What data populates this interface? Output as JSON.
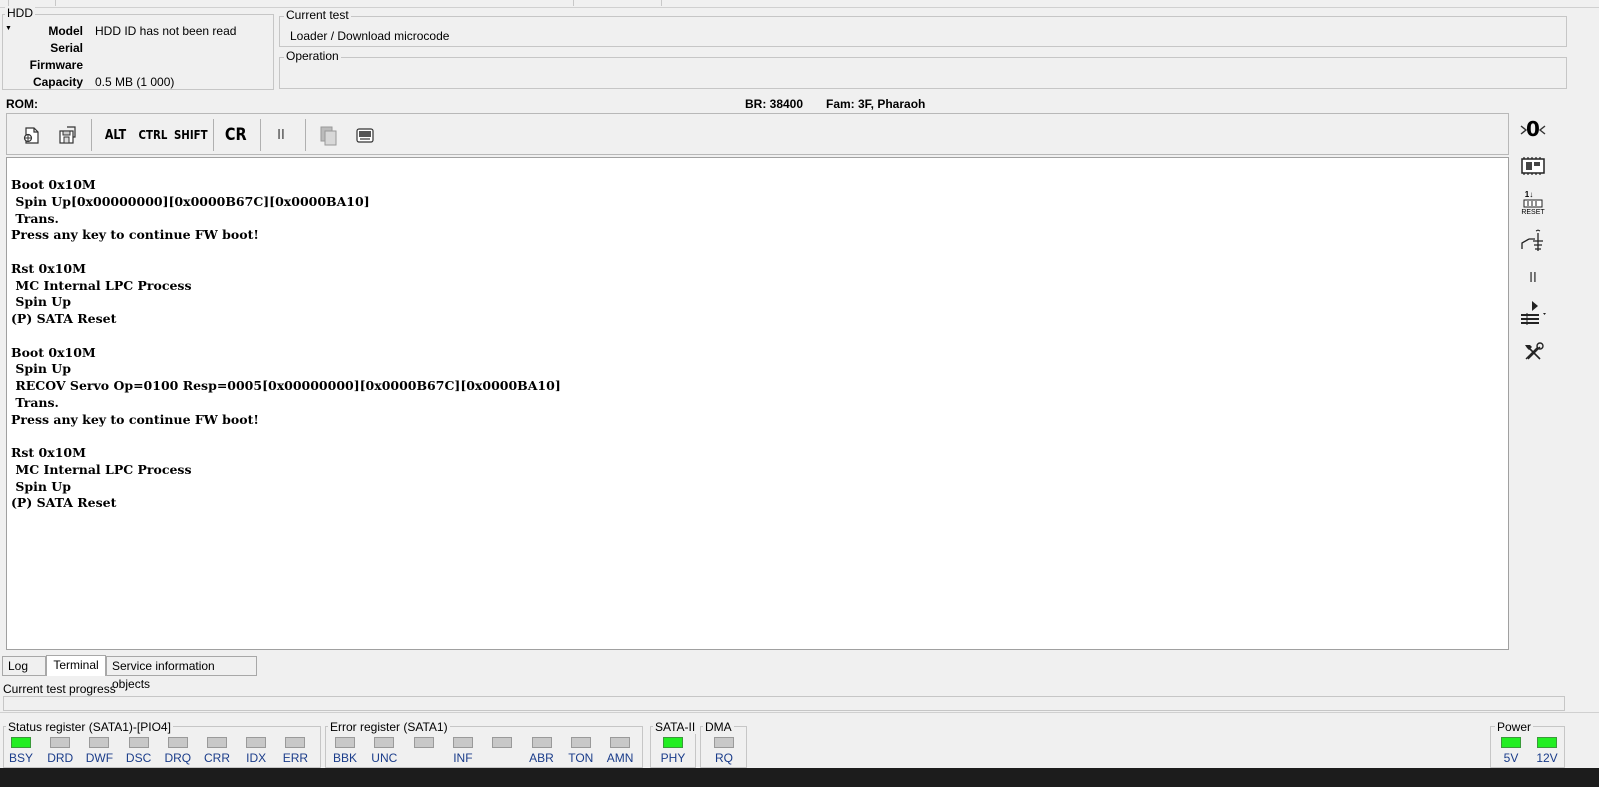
{
  "hdd": {
    "label": "HDD",
    "rows": [
      {
        "key": "Model",
        "value": "HDD ID has not been read"
      },
      {
        "key": "Serial",
        "value": ""
      },
      {
        "key": "Firmware",
        "value": ""
      },
      {
        "key": "Capacity",
        "value": "0.5 MB (1 000)"
      }
    ]
  },
  "current_test": {
    "label": "Current test",
    "value": "Loader / Download microcode"
  },
  "operation": {
    "label": "Operation",
    "value": ""
  },
  "status_line": {
    "rom": "ROM:",
    "br": "BR: 38400",
    "fam": "Fam: 3F, Pharaoh"
  },
  "toolbar": {
    "alt": "ALT",
    "ctrl": "CTRL",
    "shift": "SHIFT",
    "cr": "CR",
    "pause": "II"
  },
  "terminal_lines": [
    "Boot 0x10M",
    " Spin Up[0x00000000][0x0000B67C][0x0000BA10]",
    " Trans.",
    "Press any key to continue FW boot!",
    "",
    "Rst 0x10M",
    " MC Internal LPC Process",
    " Spin Up",
    "(P) SATA Reset",
    "",
    "Boot 0x10M",
    " Spin Up",
    " RECOV Servo Op=0100 Resp=0005[0x00000000][0x0000B67C][0x0000BA10]",
    " Trans.",
    "Press any key to continue FW boot!",
    "",
    "Rst 0x10M",
    " MC Internal LPC Process",
    " Spin Up",
    "(P) SATA Reset"
  ],
  "right_toolbar": {
    "zero": "0",
    "reset_label": "RESET",
    "reset_nums": "1↓",
    "pause": "II"
  },
  "tabs": [
    "Log",
    "Terminal",
    "Service information objects"
  ],
  "active_tab": "Terminal",
  "progress": {
    "label": "Current test progress",
    "value": 0
  },
  "status_register": {
    "label": "Status register (SATA1)-[PIO4]",
    "leds": [
      {
        "name": "BSY",
        "on": true
      },
      {
        "name": "DRD",
        "on": false
      },
      {
        "name": "DWF",
        "on": false
      },
      {
        "name": "DSC",
        "on": false
      },
      {
        "name": "DRQ",
        "on": false
      },
      {
        "name": "CRR",
        "on": false
      },
      {
        "name": "IDX",
        "on": false
      },
      {
        "name": "ERR",
        "on": false
      }
    ]
  },
  "error_register": {
    "label": "Error register (SATA1)",
    "leds": [
      {
        "name": "BBK",
        "on": false
      },
      {
        "name": "UNC",
        "on": false
      },
      {
        "name": "",
        "on": false
      },
      {
        "name": "INF",
        "on": false
      },
      {
        "name": "",
        "on": false
      },
      {
        "name": "ABR",
        "on": false
      },
      {
        "name": "TON",
        "on": false
      },
      {
        "name": "AMN",
        "on": false
      }
    ]
  },
  "sata": {
    "label": "SATA-II",
    "led": {
      "name": "PHY",
      "on": true
    }
  },
  "dma": {
    "label": "DMA",
    "led": {
      "name": "RQ",
      "on": false
    }
  },
  "power": {
    "label": "Power",
    "leds": [
      {
        "name": "5V",
        "on": true
      },
      {
        "name": "12V",
        "on": true
      }
    ]
  },
  "colors": {
    "led_on": "#22ee22",
    "led_off": "#c8c8c8",
    "led_label": "#1a3c8a"
  }
}
